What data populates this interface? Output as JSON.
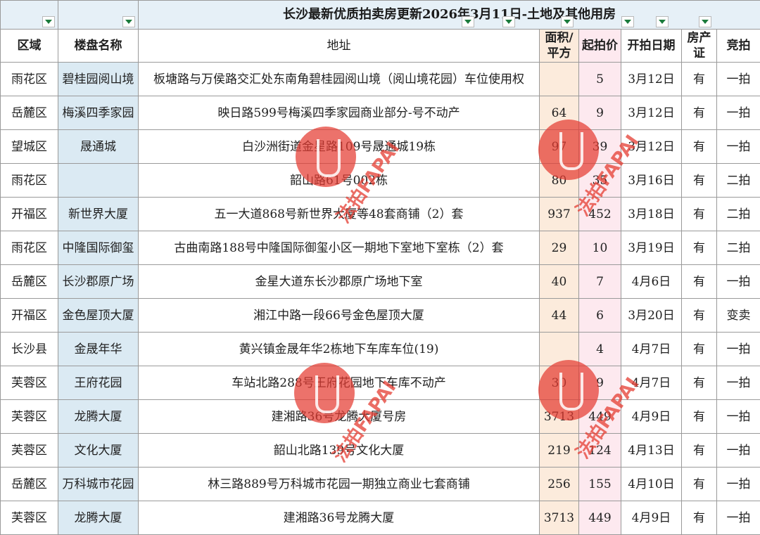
{
  "title": "长沙最新优质拍卖房更新2026年3月11日-土地及其他用房",
  "headers": {
    "district": "区域",
    "project": "楼盘名称",
    "address": "地址",
    "area": "面积/平方",
    "price": "起拍价",
    "date": "开拍日期",
    "cert": "房产证",
    "round": "竞拍"
  },
  "rows": [
    {
      "district": "雨花区",
      "project": "碧桂园阅山境",
      "address": "板塘路与万侯路交汇处东南角碧桂园阅山境（阅山境花园）车位使用权",
      "area": "",
      "price": "5",
      "date": "3月12日",
      "cert": "有",
      "round": "一拍"
    },
    {
      "district": "岳麓区",
      "project": "梅溪四季家园",
      "address": "映日路599号梅溪四季家园商业部分-号不动产",
      "area": "64",
      "price": "9",
      "date": "3月12日",
      "cert": "有",
      "round": "一拍"
    },
    {
      "district": "望城区",
      "project": "晟通城",
      "address": "白沙洲街道金星路109号晟通城19栋",
      "area": "97",
      "price": "39",
      "date": "3月12日",
      "cert": "有",
      "round": "一拍"
    },
    {
      "district": "雨花区",
      "project": "",
      "address": "韶山路61号002栋",
      "area": "80",
      "price": "35",
      "date": "3月16日",
      "cert": "有",
      "round": "二拍"
    },
    {
      "district": "开福区",
      "project": "新世界大厦",
      "address": "五一大道868号新世界大厦等48套商铺（2）套",
      "area": "937",
      "price": "452",
      "date": "3月18日",
      "cert": "有",
      "round": "二拍"
    },
    {
      "district": "雨花区",
      "project": "中隆国际御玺",
      "address": "古曲南路188号中隆国际御玺小区一期地下室地下室栋（2）套",
      "area": "29",
      "price": "10",
      "date": "3月19日",
      "cert": "有",
      "round": "二拍"
    },
    {
      "district": "岳麓区",
      "project": "长沙郡原广场",
      "address": "金星大道东长沙郡原广场地下室",
      "area": "40",
      "price": "7",
      "date": "4月6日",
      "cert": "有",
      "round": "一拍"
    },
    {
      "district": "开福区",
      "project": "金色屋顶大厦",
      "address": "湘江中路一段66号金色屋顶大厦",
      "area": "44",
      "price": "6",
      "date": "3月20日",
      "cert": "有",
      "round": "变卖"
    },
    {
      "district": "长沙县",
      "project": "金晟年华",
      "address": "黄兴镇金晟年华2栋地下车库车位(19)",
      "area": "",
      "price": "4",
      "date": "4月7日",
      "cert": "有",
      "round": "一拍"
    },
    {
      "district": "芙蓉区",
      "project": "王府花园",
      "address": "车站北路288号王府花园地下车库不动产",
      "area": "30",
      "price": "9",
      "date": "4月7日",
      "cert": "有",
      "round": "一拍"
    },
    {
      "district": "芙蓉区",
      "project": "龙腾大厦",
      "address": "建湘路36号龙腾大厦号房",
      "area": "3713",
      "price": "449",
      "date": "4月9日",
      "cert": "有",
      "round": "一拍"
    },
    {
      "district": "芙蓉区",
      "project": "文化大厦",
      "address": "韶山北路139号文化大厦",
      "area": "219",
      "price": "124",
      "date": "4月13日",
      "cert": "有",
      "round": "一拍"
    },
    {
      "district": "岳麓区",
      "project": "万科城市花园",
      "address": "林三路889号万科城市花园一期独立商业七套商铺",
      "area": "256",
      "price": "155",
      "date": "4月10日",
      "cert": "有",
      "round": "一拍"
    },
    {
      "district": "芙蓉区",
      "project": "龙腾大厦",
      "address": "建湘路36号龙腾大厦",
      "area": "3713",
      "price": "449",
      "date": "4月9日",
      "cert": "有",
      "round": "一拍"
    }
  ],
  "watermark": "法拍FAPAI",
  "colors": {
    "header_red": "#e10000",
    "title_bg": "#e6f0f7",
    "name_col_bg": "#dbeaf3",
    "area_col_bg": "#fcebdc",
    "price_col_bg": "#fde9ef",
    "filter_arrow": "#1b7b3c",
    "watermark": "#e43c32"
  }
}
